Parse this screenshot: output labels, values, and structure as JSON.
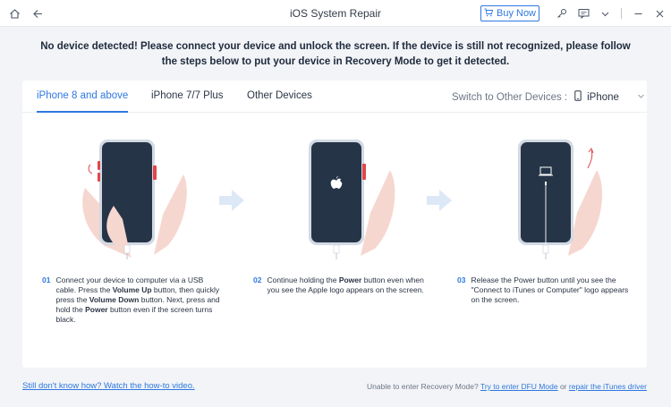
{
  "window": {
    "title": "iOS System Repair",
    "buy_now": "Buy Now"
  },
  "headline": "No device detected! Please connect your device and unlock the screen. If the device is still not recognized, please follow the steps below to put your device in Recovery Mode to get it detected.",
  "tabs": [
    {
      "label": "iPhone 8 and above",
      "active": true
    },
    {
      "label": "iPhone 7/7 Plus",
      "active": false
    },
    {
      "label": "Other Devices",
      "active": false
    }
  ],
  "switcher": {
    "label": "Switch to Other Devices :",
    "value": "iPhone"
  },
  "steps": [
    {
      "num": "01",
      "text_parts": [
        "Connect your device to computer via a USB cable. Press the ",
        "Volume Up",
        " button, then quickly press the ",
        "Volume Down",
        " button. Next, press and hold the ",
        "Power",
        " button even if the screen turns black."
      ]
    },
    {
      "num": "02",
      "text_parts": [
        "Continue holding the ",
        "Power",
        " button even when you see the Apple logo appears on the screen."
      ]
    },
    {
      "num": "03",
      "text_parts": [
        "Release the Power button until you see the \"Connect to iTunes or Computer\" logo appears on the screen."
      ]
    }
  ],
  "footer": {
    "left_link": "Still don't know how? Watch the how-to video.",
    "right_prefix": "Unable to enter Recovery Mode?",
    "dfu_link": "Try to enter DFU Mode",
    "or": "or",
    "itunes_link": "repair the iTunes driver"
  },
  "colors": {
    "accent": "#2e78e0",
    "phone": "#263448",
    "hand": "#f6d7cf",
    "button_highlight": "#e0464b"
  }
}
